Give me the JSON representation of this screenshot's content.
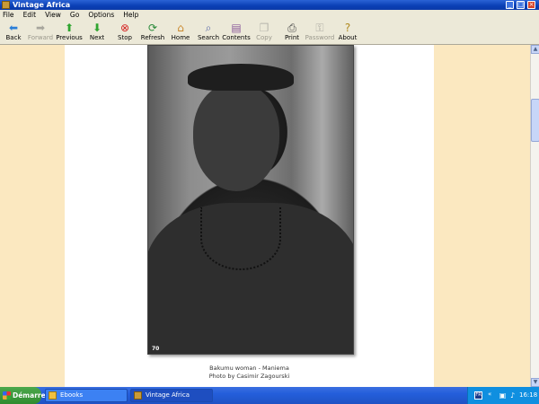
{
  "window": {
    "title": "Vintage Africa"
  },
  "menu": [
    "File",
    "Edit",
    "View",
    "Go",
    "Options",
    "Help"
  ],
  "toolbar": {
    "back": "Back",
    "forward": "Forward",
    "previous": "Previous",
    "next": "Next",
    "stop": "Stop",
    "refresh": "Refresh",
    "home": "Home",
    "search": "Search",
    "contents": "Contents",
    "copy": "Copy",
    "print": "Print",
    "password": "Password",
    "about": "About"
  },
  "page": {
    "photo_number": "70",
    "caption_line1": "Bakumu woman - Maniema",
    "caption_line2": "Photo by Casimir Zagourski"
  },
  "taskbar": {
    "start": "Démarrer",
    "task1": "Ebooks",
    "task2": "Vintage Africa",
    "lang": "FR",
    "clock": "16:18"
  }
}
